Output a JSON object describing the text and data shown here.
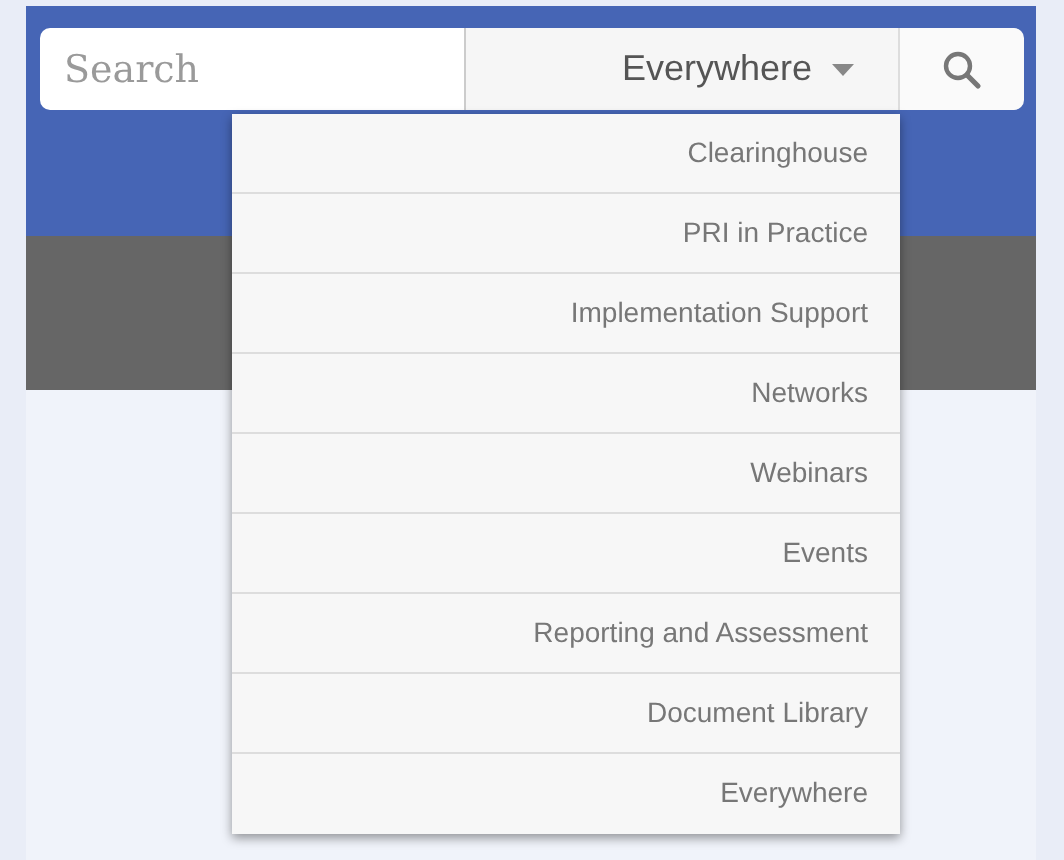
{
  "search": {
    "placeholder": "Search",
    "scope": "Everywhere"
  },
  "menu": {
    "items": [
      {
        "label": "Clearinghouse"
      },
      {
        "label": "PRI in Practice"
      },
      {
        "label": "Implementation Support"
      },
      {
        "label": "Networks"
      },
      {
        "label": "Webinars"
      },
      {
        "label": "Events"
      },
      {
        "label": "Reporting and Assessment"
      },
      {
        "label": "Document Library"
      },
      {
        "label": "Everywhere"
      }
    ]
  }
}
